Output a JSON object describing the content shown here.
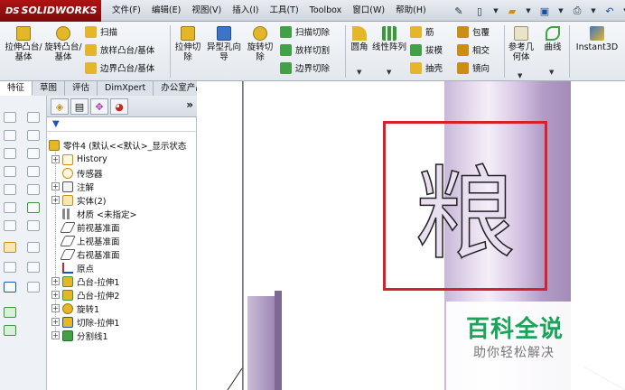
{
  "app": {
    "brand": "SOLIDWORKS",
    "brand_prefix": "DS"
  },
  "menu": {
    "items": [
      "文件(F)",
      "编辑(E)",
      "视图(V)",
      "插入(I)",
      "工具(T)",
      "Toolbox",
      "窗口(W)",
      "帮助(H)"
    ]
  },
  "ribbon": {
    "extrude_boss": "拉伸凸台/基体",
    "revolve_boss": "旋转凸台/基体",
    "sweep": "扫描",
    "loft_boss": "放样凸台/基体",
    "boundary_boss": "边界凸台/基体",
    "extrude_cut": "拉伸切除",
    "hole_wizard": "异型孔向导",
    "revolve_cut": "旋转切除",
    "swept_cut": "扫描切除",
    "lofted_cut": "放样切割",
    "boundary_cut": "边界切除",
    "fillet": "圆角",
    "linear_pattern": "线性阵列",
    "rib": "筋",
    "draft": "拔模",
    "shell": "抽壳",
    "wrap": "包覆",
    "intersect": "相交",
    "mirror": "镜向",
    "ref_geometry": "参考几何体",
    "curves": "曲线",
    "instant3d": "Instant3D"
  },
  "tabs": [
    "特征",
    "草图",
    "评估",
    "DimXpert",
    "办公室产品"
  ],
  "tree": {
    "root": "零件4 (默认<<默认>_显示状态",
    "history": "History",
    "sensors": "传感器",
    "annotations": "注解",
    "solid_bodies": "实体(2)",
    "material": "材质 <未指定>",
    "front_plane": "前视基准面",
    "top_plane": "上视基准面",
    "right_plane": "右视基准面",
    "origin": "原点",
    "boss_extrude1": "凸台-拉伸1",
    "boss_extrude2": "凸台-拉伸2",
    "revolve1": "旋转1",
    "cut_extrude1": "切除-拉伸1",
    "split_line1": "分割线1"
  },
  "viewport": {
    "engraved_char": "粮",
    "highlight_color": "#d6202a"
  },
  "watermark": {
    "title": "百科全说",
    "subtitle": "助你轻松解决"
  },
  "colors": {
    "brand_red": "#a11010",
    "accent_green": "#1aa35a",
    "part_purple": "#c8b8d8"
  }
}
